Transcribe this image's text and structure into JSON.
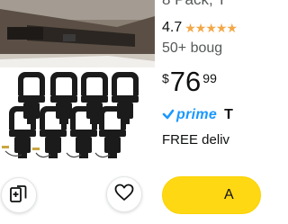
{
  "product": {
    "title_fragment": "8 Pack, T",
    "rating_value": "4.7",
    "stars": "★★★★★",
    "bought_text": "50+ boug",
    "price_symbol": "$",
    "price_whole": "76",
    "price_fraction": "99",
    "prime_label": "prime",
    "prime_extra": "T",
    "delivery_text": "FREE deliv"
  },
  "actions": {
    "add_label": "A",
    "compare_icon": "compare-cards-icon",
    "wishlist_icon": "heart-icon"
  },
  "colors": {
    "star": "#f3a847",
    "prime_blue": "#1a98ff",
    "add_button": "#ffd814"
  }
}
